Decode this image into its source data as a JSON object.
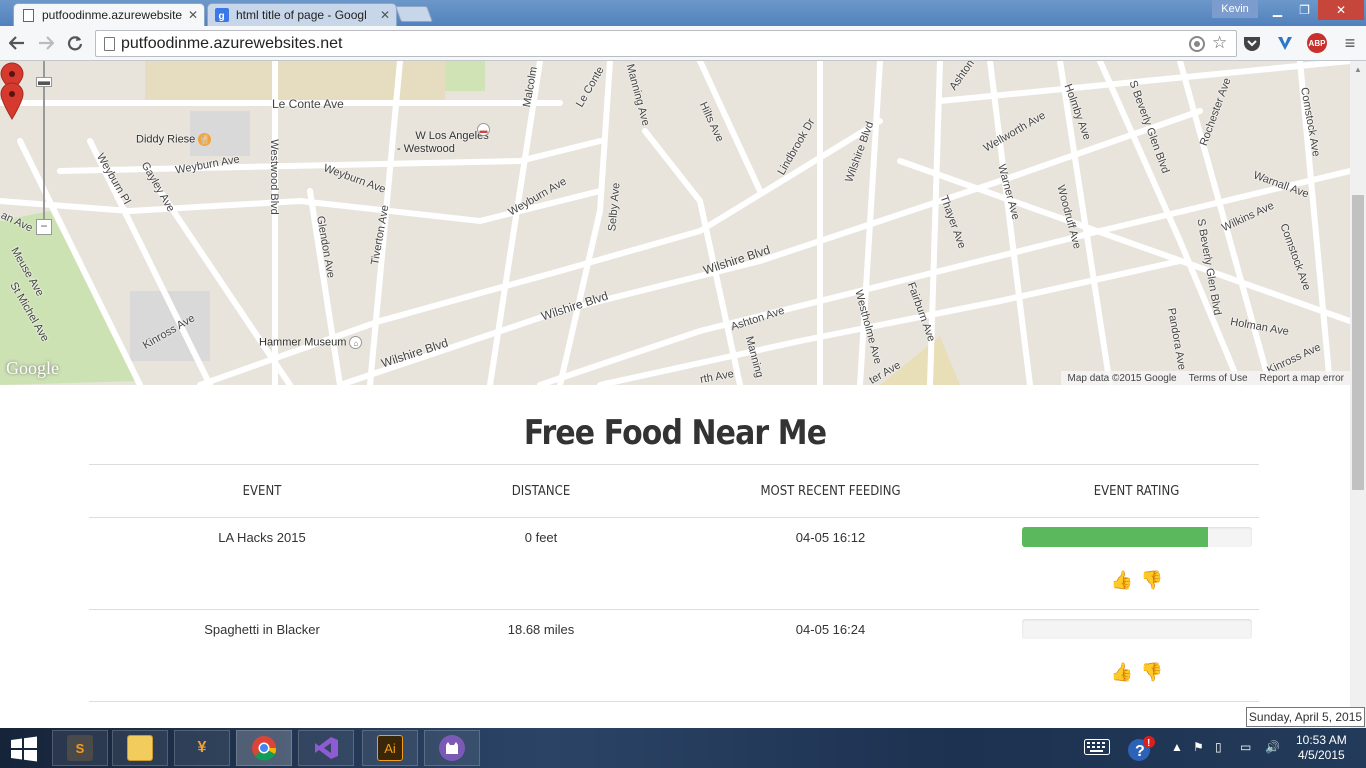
{
  "browser": {
    "tabs": [
      {
        "title": "putfoodinme.azurewebsite",
        "active": true,
        "icon": "document-icon"
      },
      {
        "title": "html title of page - Googl",
        "active": false,
        "icon": "google-icon"
      }
    ],
    "user": "Kevin",
    "url": "putfoodinme.azurewebsites.net",
    "extensions": [
      "location-icon",
      "star-icon",
      "pocket-icon",
      "bookmark-icon",
      "adblock-plus-icon",
      "menu-icon"
    ],
    "abp_label": "ABP"
  },
  "map": {
    "attribution": "Map data ©2015 Google",
    "terms": "Terms of Use",
    "report": "Report a map error",
    "logo": "Google",
    "zoom_in": "+",
    "zoom_out": "−",
    "streets": [
      "Le Conte Ave",
      "Weyburn Ave",
      "Weyburn Ave",
      "Weyburn Ave",
      "Weyburn Pl",
      "Gayley Ave",
      "Westwood Blvd",
      "Glendon Ave",
      "Tiverton Ave",
      "Selby Ave",
      "Malcolm",
      "Le Conte",
      "Manning Ave",
      "Hilts Ave",
      "Lindbrook Dr",
      "Wilshire Blvd",
      "Wilshire Blvd",
      "Wilshire Blvd",
      "Wilshire Blvd",
      "Kinross Ave",
      "Ashton Ave",
      "Westholme Ave",
      "Fairburn Ave",
      "Thayer Ave",
      "Warner Ave",
      "Woodruff Ave",
      "Wellworth Ave",
      "Holmby Ave",
      "S Beverly Glen Blvd",
      "S Beverly Glen Blvd",
      "Rochester Ave",
      "Comstock Ave",
      "Comstock Ave",
      "Warnall Ave",
      "Wilkins Ave",
      "Pandora Ave",
      "Holman Ave",
      "Kinross Ave",
      "Meuse Ave",
      "St Michel Ave",
      "Ashton",
      "Manning",
      "rth Ave",
      "ter Ave",
      "an Ave"
    ],
    "pois": [
      {
        "name": "Diddy Riese",
        "icon": "restaurant-icon"
      },
      {
        "name": "W Los Angeles\n- Westwood",
        "icon": "hotel-icon"
      },
      {
        "name": "Hammer Museum",
        "icon": "museum-icon"
      }
    ]
  },
  "page": {
    "title": "Free Food Near Me",
    "columns": [
      "EVENT",
      "DISTANCE",
      "MOST RECENT FEEDING",
      "EVENT RATING"
    ],
    "events": [
      {
        "name": "LA Hacks 2015",
        "distance": "0 feet",
        "feeding": "04-05 16:12",
        "rating": 0.81
      },
      {
        "name": "Spaghetti in Blacker",
        "distance": "18.68 miles",
        "feeding": "04-05 16:24",
        "rating": 0
      }
    ],
    "colors": {
      "rating_bar": "#5cb85c",
      "heading": "#333333"
    }
  },
  "taskbar": {
    "apps": [
      "sublime-text-icon",
      "file-explorer-icon",
      "yammer-icon",
      "chrome-icon",
      "visual-studio-icon",
      "illustrator-icon",
      "github-icon"
    ],
    "illustrator_label": "Ai",
    "sublime_label": "S",
    "time": "10:53 AM",
    "date": "4/5/2015",
    "tooltip": "Sunday, April 5, 2015"
  }
}
